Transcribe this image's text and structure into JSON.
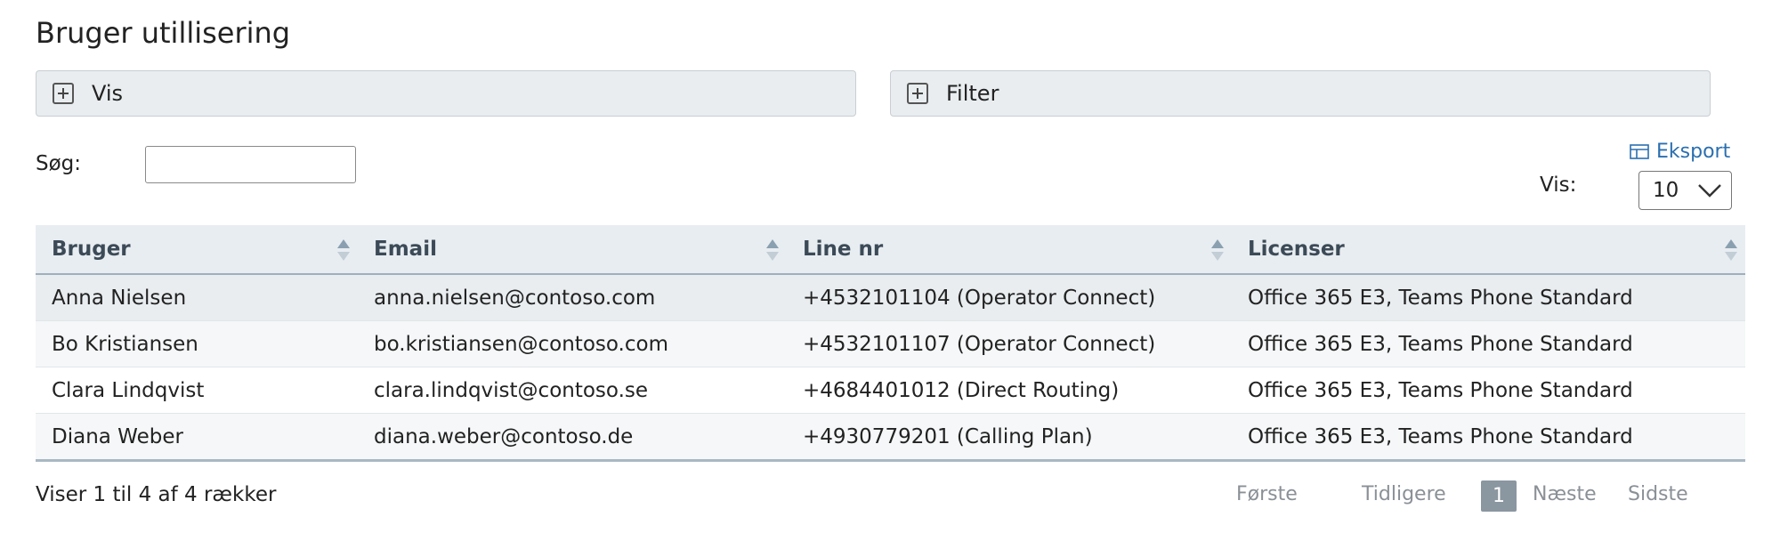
{
  "page": {
    "title": "Bruger utillisering"
  },
  "panels": {
    "vis_label": "Vis",
    "filter_label": "Filter"
  },
  "search": {
    "label": "Søg:",
    "value": ""
  },
  "export": {
    "label": "Eksport"
  },
  "page_size": {
    "label": "Vis:",
    "selected": "10"
  },
  "table": {
    "columns": [
      "Bruger",
      "Email",
      "Line nr",
      "Licenser"
    ],
    "rows": [
      [
        "Anna Nielsen",
        "anna.nielsen@contoso.com",
        "+4532101104 (Operator Connect)",
        "Office 365 E3, Teams Phone Standard"
      ],
      [
        "Bo Kristiansen",
        "bo.kristiansen@contoso.com",
        "+4532101107 (Operator Connect)",
        "Office 365 E3, Teams Phone Standard"
      ],
      [
        "Clara Lindqvist",
        "clara.lindqvist@contoso.se",
        "+4684401012 (Direct Routing)",
        "Office 365 E3, Teams Phone Standard"
      ],
      [
        "Diana Weber",
        "diana.weber@contoso.de",
        "+4930779201 (Calling Plan)",
        "Office 365 E3, Teams Phone Standard"
      ]
    ]
  },
  "footer": {
    "info": "Viser 1 til 4 af 4 rækker",
    "first": "Første",
    "prev": "Tidligere",
    "current_page": "1",
    "next": "Næste",
    "last": "Sidste"
  },
  "icons": {
    "panel_toggle": "plus-square-icon",
    "export": "table-icon",
    "select": "chevron-down-icon",
    "sort": "sort-icon"
  },
  "colors": {
    "link": "#2a6fb0",
    "header_bg": "#e8edf1",
    "active_page": "#8a96a0"
  }
}
